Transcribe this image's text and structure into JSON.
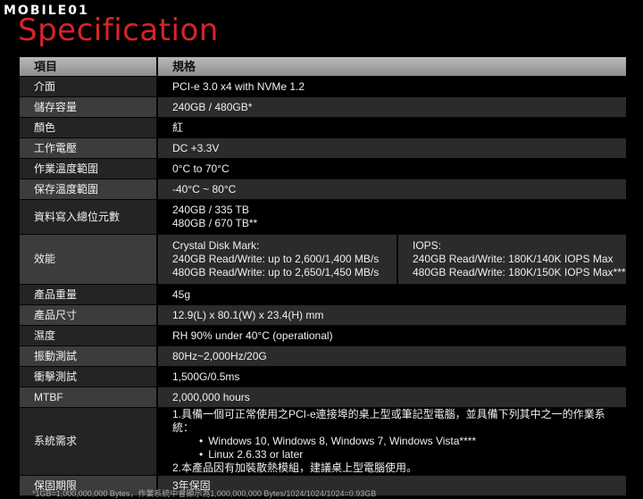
{
  "brand": {
    "name": "MOBILE01"
  },
  "page_title": "Specification",
  "headers": {
    "item": "項目",
    "spec": "規格"
  },
  "rows": [
    {
      "label": "介面",
      "value": "PCI-e 3.0 x4 with NVMe 1.2"
    },
    {
      "label": "儲存容量",
      "value": "240GB / 480GB*"
    },
    {
      "label": "顏色",
      "value": "紅"
    },
    {
      "label": "工作電壓",
      "value": "DC +3.3V"
    },
    {
      "label": "作業溫度範圍",
      "value": "0°C to 70°C"
    },
    {
      "label": "保存溫度範圍",
      "value": "-40°C ~ 80°C"
    },
    {
      "label": "資料寫入總位元數",
      "lines": [
        "240GB / 335 TB",
        "480GB / 670 TB**"
      ]
    },
    {
      "label": "效能",
      "left": [
        "Crystal Disk Mark:",
        "240GB Read/Write: up to 2,600/1,400 MB/s",
        "480GB Read/Write: up to 2,650/1,450 MB/s"
      ],
      "right": [
        "IOPS:",
        "240GB  Read/Write: 180K/140K IOPS Max",
        "480GB  Read/Write: 180K/150K IOPS Max***"
      ]
    },
    {
      "label": "產品重量",
      "value": "45g"
    },
    {
      "label": "產品尺寸",
      "value": "12.9(L) x 80.1(W) x 23.4(H) mm"
    },
    {
      "label": "濕度",
      "value": "RH 90% under 40°C (operational)"
    },
    {
      "label": "振動測試",
      "value": "80Hz~2,000Hz/20G"
    },
    {
      "label": "衝擊測試",
      "value": "1,500G/0.5ms"
    },
    {
      "label": "MTBF",
      "value": "2,000,000 hours"
    },
    {
      "label": "系統需求",
      "intro": "1.具備一個可正常使用之PCI-e連接埠的桌上型或筆記型電腦，並具備下列其中之一的作業系統：",
      "os": [
        "Windows 10, Windows 8, Windows 7, Windows Vista****",
        "Linux 2.6.33 or later"
      ],
      "note": "2.本產品因有加裝散熱模組，建議桌上型電腦使用。"
    },
    {
      "label": "保固期限",
      "value": "3年保固"
    }
  ],
  "footnote": "*1GB=1,000,000,000 Bytes，作業系統中會顯示為1,000,000,000 Bytes/1024/1024/1024=0.93GB"
}
